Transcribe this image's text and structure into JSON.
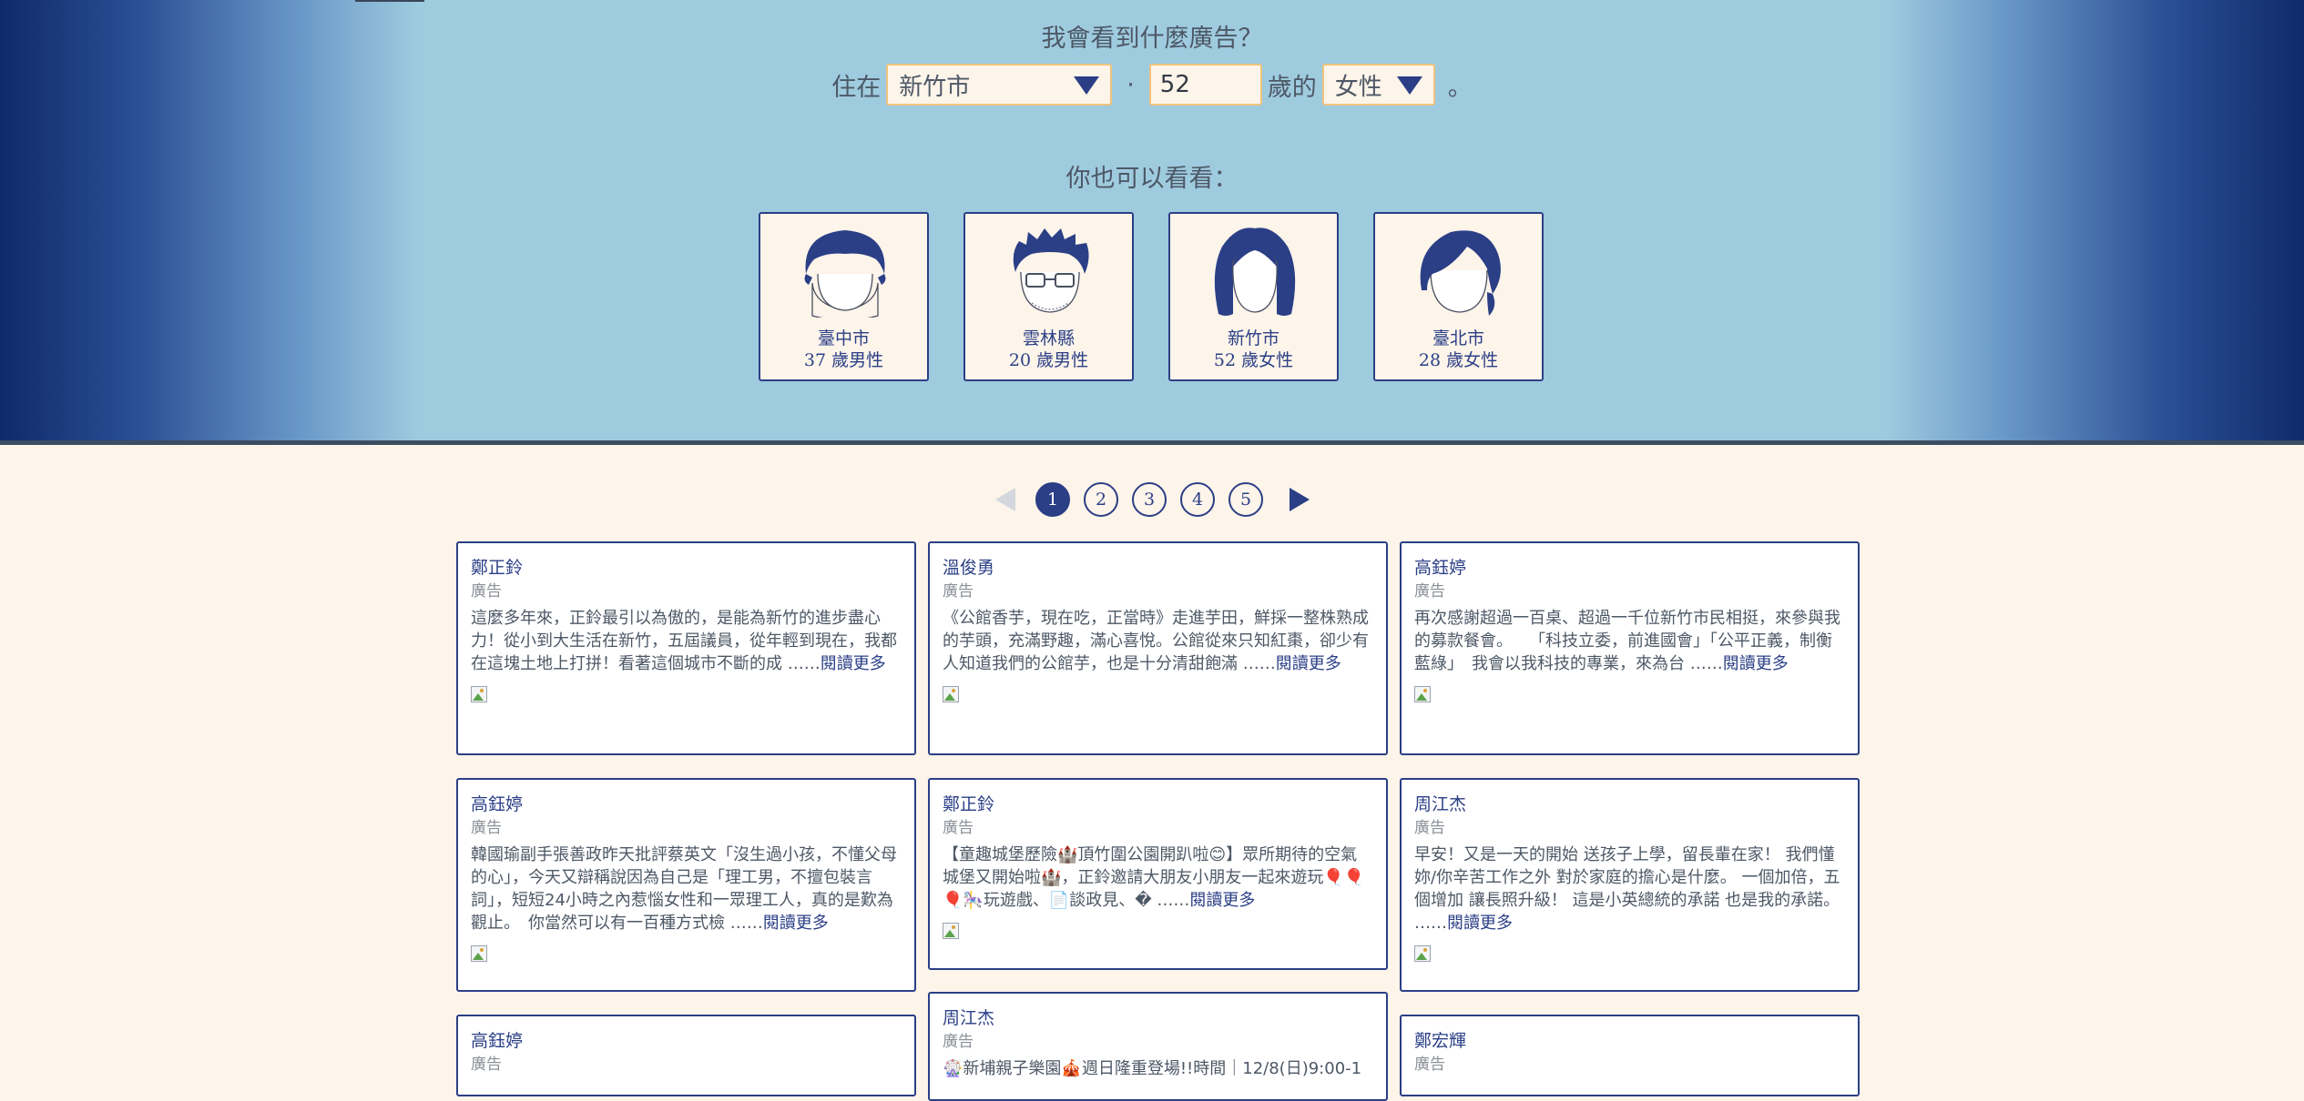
{
  "header": {
    "question": "我會看到什麼廣告？",
    "live_label": "住在",
    "city_value": "新竹市",
    "separator": "·",
    "age_value": "52",
    "age_label": "歲的",
    "gender_value": "女性",
    "period": "。",
    "also_see": "你也可以看看："
  },
  "personas": [
    {
      "city": "臺中市",
      "desc": "37 歲男性",
      "icon": "male-short-hair-avatar-icon"
    },
    {
      "city": "雲林縣",
      "desc": "20 歲男性",
      "icon": "male-glasses-avatar-icon"
    },
    {
      "city": "新竹市",
      "desc": "52 歲女性",
      "icon": "female-bob-hair-avatar-icon"
    },
    {
      "city": "臺北市",
      "desc": "28 歲女性",
      "icon": "female-side-hair-avatar-icon"
    }
  ],
  "pagination": {
    "pages": [
      "1",
      "2",
      "3",
      "4",
      "5"
    ],
    "current": "1"
  },
  "ads": [
    {
      "name": "鄭正鈴",
      "tag": "廣告",
      "text": "這麼多年來，正鈴最引以為傲的，是能為新竹的進步盡心力！從小到大生活在新竹，五屆議員，從年輕到現在，我都在這塊土地上打拼！看著這個城市不斷的成 ……",
      "more": "閱讀更多"
    },
    {
      "name": "溫俊勇",
      "tag": "廣告",
      "text": "《公館香芋，現在吃，正當時》走進芋田，鮮採一整株熟成的芋頭，充滿野趣，滿心喜悅。公館從來只知紅棗，卻少有人知道我們的公館芋，也是十分清甜飽滿 ……",
      "more": "閱讀更多"
    },
    {
      "name": "高鈺婷",
      "tag": "廣告",
      "text": "再次感謝超過一百桌、超過一千位新竹市民相挺，來參與我的募款餐會。　　「科技立委，前進國會」「公平正義，制衡藍綠」　我會以我科技的專業，來為台 ……",
      "more": "閱讀更多"
    },
    {
      "name": "高鈺婷",
      "tag": "廣告",
      "text": "韓國瑜副手張善政昨天批評蔡英文「沒生過小孩，不懂父母的心」，今天又辯稱說因為自己是「理工男，不擅包裝言詞」，短短24小時之內惹惱女性和一眾理工人，真的是歎為觀止。　你當然可以有一百種方式檢 ……",
      "more": "閱讀更多"
    },
    {
      "name": "鄭正鈴",
      "tag": "廣告",
      "text": "【童趣城堡歷險🏰頂竹圍公園開趴啦😊】眾所期待的空氣城堡又開始啦🏰，正鈴邀請大朋友小朋友一起來遊玩🎈🎈🎈🎠玩遊戲、📄談政見、� ……",
      "more": "閱讀更多"
    },
    {
      "name": "周江杰",
      "tag": "廣告",
      "text": "早安！又是一天的開始 送孩子上學，留長輩在家！ 我們懂妳/你辛苦工作之外 對於家庭的擔心是什麼。 一個加倍，五個增加 讓長照升級！ 這是小英總統的承諾 也是我的承諾。 ……",
      "more": "閱讀更多"
    },
    {
      "name": "高鈺婷",
      "tag": "廣告",
      "text": "",
      "more": ""
    },
    {
      "name": "周江杰",
      "tag": "廣告",
      "text": "🎡新埔親子樂園🎪週日隆重登場!!時間｜12/8(日)9:00-1",
      "more": ""
    },
    {
      "name": "鄭宏輝",
      "tag": "廣告",
      "text": "",
      "more": ""
    }
  ],
  "colors": {
    "accent": "#2b3f86",
    "input_border": "#f0c37c",
    "band": "#9fcbdf",
    "page_bg": "#fdf4ea"
  }
}
